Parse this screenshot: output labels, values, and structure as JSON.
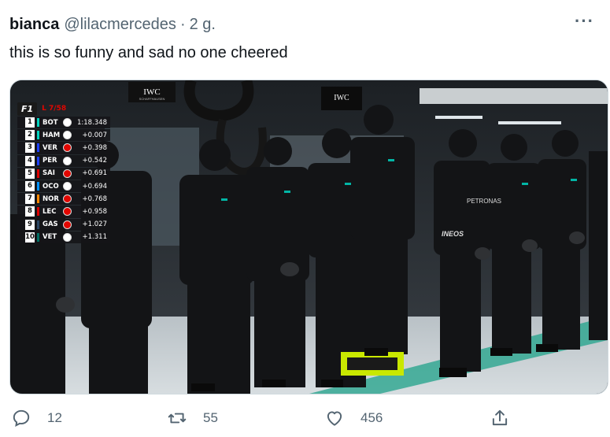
{
  "tweet": {
    "display_name": "bianca",
    "handle": "@lilacmercedes",
    "separator": "·",
    "time": "2 g.",
    "more_label": "···",
    "text": "this is so funny and sad no one cheered"
  },
  "media": {
    "sponsor_sign_1": "IWC",
    "sponsor_sign_2": "IWC",
    "sponsor_sub": "SCHAFFHAUSEN",
    "shirt_text": "PETRONAS",
    "vest_text": "INEOS",
    "leaderboard": {
      "logo": "F1",
      "lap_text": "L 7/58",
      "rows": [
        {
          "pos": "1",
          "code": "BOT",
          "gap": "1:18.348",
          "team_color": "#00d2be",
          "tyre": "#ffffff"
        },
        {
          "pos": "2",
          "code": "HAM",
          "gap": "+0.007",
          "team_color": "#00d2be",
          "tyre": "#ffffff"
        },
        {
          "pos": "3",
          "code": "VER",
          "gap": "+0.398",
          "team_color": "#1e41ff",
          "tyre": "#e10600"
        },
        {
          "pos": "4",
          "code": "PER",
          "gap": "+0.542",
          "team_color": "#1e41ff",
          "tyre": "#ffffff"
        },
        {
          "pos": "5",
          "code": "SAI",
          "gap": "+0.691",
          "team_color": "#dc0000",
          "tyre": "#e10600"
        },
        {
          "pos": "6",
          "code": "OCO",
          "gap": "+0.694",
          "team_color": "#0090ff",
          "tyre": "#ffffff"
        },
        {
          "pos": "7",
          "code": "NOR",
          "gap": "+0.768",
          "team_color": "#ff8700",
          "tyre": "#e10600"
        },
        {
          "pos": "8",
          "code": "LEC",
          "gap": "+0.958",
          "team_color": "#dc0000",
          "tyre": "#e10600"
        },
        {
          "pos": "9",
          "code": "GAS",
          "gap": "+1.027",
          "team_color": "#2b4562",
          "tyre": "#e10600"
        },
        {
          "pos": "10",
          "code": "VET",
          "gap": "+1.311",
          "team_color": "#006f62",
          "tyre": "#ffffff"
        }
      ]
    }
  },
  "actions": {
    "reply_count": "12",
    "retweet_count": "55",
    "like_count": "456"
  },
  "colors": {
    "text": "#0f1419",
    "muted": "#536471",
    "mercedes_teal": "#00d2be"
  }
}
